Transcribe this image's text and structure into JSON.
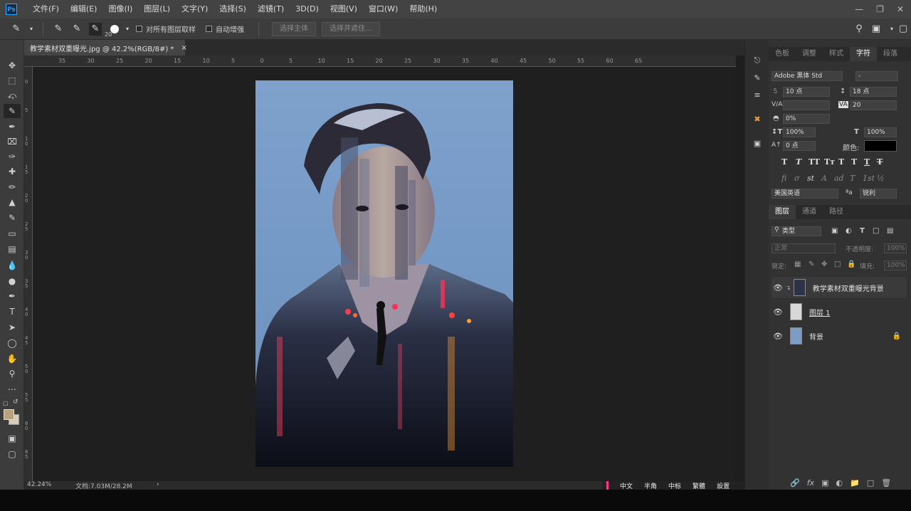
{
  "menu": {
    "logo": "Ps",
    "items": [
      "文件(F)",
      "编辑(E)",
      "图像(I)",
      "图层(L)",
      "文字(Y)",
      "选择(S)",
      "滤镜(T)",
      "3D(D)",
      "视图(V)",
      "窗口(W)",
      "帮助(H)"
    ]
  },
  "options": {
    "brush_size": "20",
    "sample_all_layers": "对所有图层取样",
    "auto_enhance": "自动增强",
    "select_subject": "选择主体",
    "select_and_mask": "选择并遮住..."
  },
  "document": {
    "tab_title": "教学素材双重曝光.jpg @ 42.2%(RGB/8#) *",
    "close": "×"
  },
  "ruler_h": [
    "35",
    "30",
    "25",
    "20",
    "15",
    "10",
    "5",
    "0",
    "5",
    "10",
    "15",
    "20",
    "25",
    "30",
    "35",
    "40",
    "45",
    "50",
    "55",
    "60",
    "65"
  ],
  "ruler_v": [
    "0",
    "5",
    "1 0",
    "1 5",
    "2 0",
    "2 5",
    "3 0",
    "3 5",
    "4 0",
    "4 5",
    "5 0",
    "5 5",
    "6 0",
    "6 5"
  ],
  "char_panel": {
    "tabs": [
      "色板",
      "调整",
      "样式",
      "字符",
      "段落"
    ],
    "font_family": "Adobe 黑体 Std",
    "font_style": "-",
    "size": "10 点",
    "leading": "18 点",
    "kerning_label": "V/A",
    "tracking": "20",
    "scale_pct": "0%",
    "vscale": "100%",
    "hscale": "100%",
    "baseline": "0 点",
    "color_label": "颜色:",
    "language": "美国英语",
    "aa_label": "a",
    "antialias": "锐利"
  },
  "layers_panel": {
    "tabs": [
      "图层",
      "通道",
      "路径"
    ],
    "filter": "类型",
    "blend": "正常",
    "opacity_label": "不透明度:",
    "opacity": "100%",
    "lock_label": "锁定:",
    "fill_label": "填充:",
    "fill": "100%",
    "layers": [
      {
        "name": "教学素材双重曝光背景"
      },
      {
        "name": "图层 1"
      },
      {
        "name": "背景"
      }
    ]
  },
  "status": {
    "zoom": "42.24%",
    "doc_size": "文档:7.03M/28.2M",
    "arrow": "›"
  },
  "ime": [
    "中文",
    "半角",
    "中标",
    "繁體",
    "設置"
  ],
  "colors": {
    "menubar": "#434343",
    "panel": "#323232",
    "canvas": "#1f1f1f",
    "accent": "#31a8ff",
    "photo_sky": "#7b9dc6"
  }
}
